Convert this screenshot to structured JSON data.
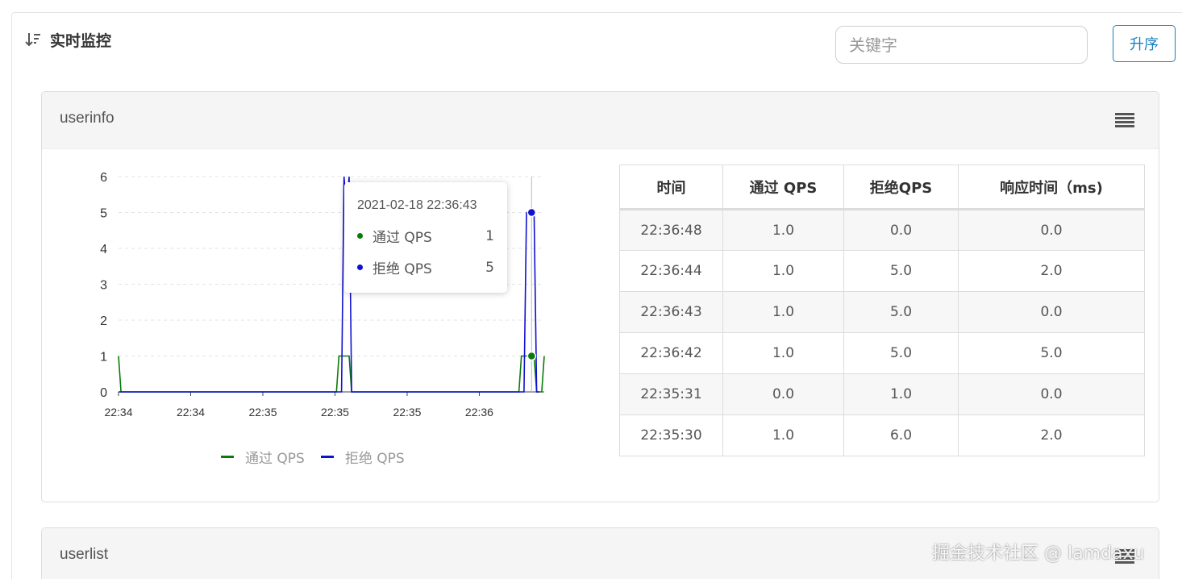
{
  "header": {
    "title": "实时监控",
    "sort_icon": "sort-descending-icon"
  },
  "search": {
    "placeholder": "关键字",
    "value": ""
  },
  "sort_button": {
    "label": "升序"
  },
  "cards": [
    {
      "title": "userinfo",
      "menu_icon": "hamburger-menu-icon"
    },
    {
      "title": "userlist",
      "menu_icon": "hamburger-menu-icon"
    }
  ],
  "tooltip": {
    "time": "2021-02-18 22:36:43",
    "rows": [
      {
        "name": "通过 QPS",
        "value": "1",
        "color": "#0a7a0a"
      },
      {
        "name": "拒绝 QPS",
        "value": "5",
        "color": "#1010d0"
      }
    ]
  },
  "legend": [
    {
      "name": "通过 QPS",
      "color": "#0a7a0a"
    },
    {
      "name": "拒绝 QPS",
      "color": "#1010d0"
    }
  ],
  "table": {
    "headers": [
      "时间",
      "通过 QPS",
      "拒绝QPS",
      "响应时间（ms)"
    ],
    "rows": [
      [
        "22:36:48",
        "1.0",
        "0.0",
        "0.0"
      ],
      [
        "22:36:44",
        "1.0",
        "5.0",
        "2.0"
      ],
      [
        "22:36:43",
        "1.0",
        "5.0",
        "0.0"
      ],
      [
        "22:36:42",
        "1.0",
        "5.0",
        "5.0"
      ],
      [
        "22:35:31",
        "0.0",
        "1.0",
        "0.0"
      ],
      [
        "22:35:30",
        "1.0",
        "6.0",
        "2.0"
      ]
    ]
  },
  "chart_data": {
    "type": "line",
    "x_ticks": [
      "22:34",
      "22:34",
      "22:35",
      "22:35",
      "22:35",
      "22:36"
    ],
    "y_ticks": [
      0,
      1,
      2,
      3,
      4,
      5,
      6
    ],
    "ylim": [
      0,
      6
    ],
    "grid": true,
    "legend_position": "bottom",
    "series": [
      {
        "name": "通过 QPS",
        "color": "#0a7a0a",
        "x": [
          "22:34:00",
          "22:34:01",
          "22:34:02",
          "22:35:25",
          "22:35:26",
          "22:35:27",
          "22:35:31",
          "22:35:32",
          "22:35:33",
          "22:36:37",
          "22:36:38",
          "22:36:39",
          "22:36:43",
          "22:36:44",
          "22:36:45",
          "22:36:46",
          "22:36:47",
          "22:36:48"
        ],
        "y": [
          1,
          0,
          0,
          0,
          0,
          1,
          1,
          0,
          0,
          0,
          0,
          1,
          1,
          1,
          0,
          0,
          0,
          1
        ]
      },
      {
        "name": "拒绝 QPS",
        "color": "#1010d0",
        "x": [
          "22:34:00",
          "22:35:27",
          "22:35:28",
          "22:35:29",
          "22:35:30",
          "22:35:31",
          "22:35:32",
          "22:35:33",
          "22:36:38",
          "22:36:39",
          "22:36:40",
          "22:36:41",
          "22:36:42",
          "22:36:43",
          "22:36:44",
          "22:36:45",
          "22:36:46"
        ],
        "y": [
          0,
          0,
          0,
          6,
          5,
          6,
          0,
          0,
          0,
          0,
          0,
          5,
          5,
          5,
          5,
          0,
          0
        ]
      }
    ]
  },
  "watermark": "掘金技术社区 @ lamdaxu"
}
